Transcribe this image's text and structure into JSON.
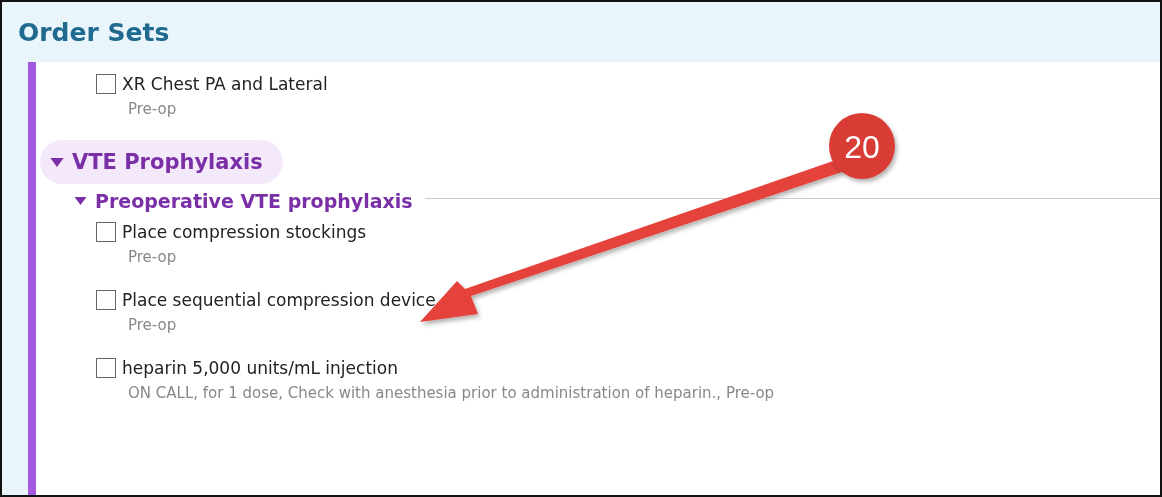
{
  "header": {
    "title": "Order Sets"
  },
  "items": [
    {
      "label": "XR Chest PA and Lateral",
      "detail": "Pre-op",
      "checked": false
    }
  ],
  "groups": [
    {
      "title": "VTE Prophylaxis",
      "expanded": true,
      "subgroups": [
        {
          "title": "Preoperative VTE prophylaxis",
          "expanded": true,
          "items": [
            {
              "label": "Place compression stockings",
              "detail": "Pre-op",
              "checked": false
            },
            {
              "label": "Place sequential compression device",
              "detail": "Pre-op",
              "checked": false
            },
            {
              "label": "heparin 5,000 units/mL injection",
              "detail": "ON CALL, for 1 dose, Check with anesthesia prior to administration of heparin., Pre-op",
              "checked": false
            }
          ]
        }
      ]
    }
  ],
  "annotation": {
    "label": "20"
  }
}
